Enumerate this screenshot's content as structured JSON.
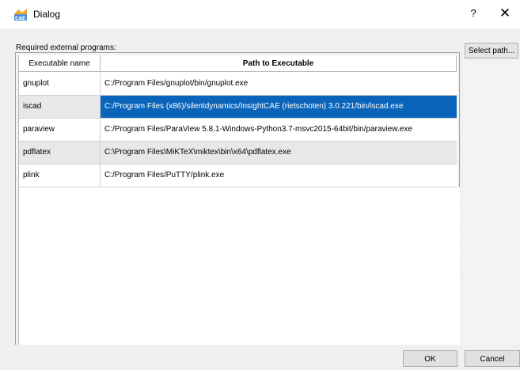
{
  "window": {
    "title": "Dialog",
    "help_label": "?",
    "close_label": "✕"
  },
  "section": {
    "label": "Required external programs:"
  },
  "table": {
    "columns": [
      "Executable name",
      "Path to Executable"
    ],
    "rows": [
      {
        "name": "gnuplot",
        "path": "C:/Program Files/gnuplot/bin/gnuplot.exe"
      },
      {
        "name": "iscad",
        "path": "C:/Program Files (x86)/silentdynamics/InsightCAE (rietschoten) 3.0.221/bin/iscad.exe"
      },
      {
        "name": "paraview",
        "path": "C:/Program Files/ParaView 5.8.1-Windows-Python3.7-msvc2015-64bit/bin/paraview.exe"
      },
      {
        "name": "pdflatex",
        "path": "C:\\Program Files\\MiKTeX\\miktex\\bin\\x64\\pdflatex.exe"
      },
      {
        "name": "plink",
        "path": "C:/Program Files/PuTTY/plink.exe"
      }
    ],
    "selected_row": 1
  },
  "buttons": {
    "select_path": "Select path...",
    "ok": "OK",
    "cancel": "Cancel"
  },
  "colors": {
    "selection": "#0a64ba",
    "alt_row": "#e8e8e8"
  },
  "icons": {
    "app": "cae-app-icon"
  }
}
